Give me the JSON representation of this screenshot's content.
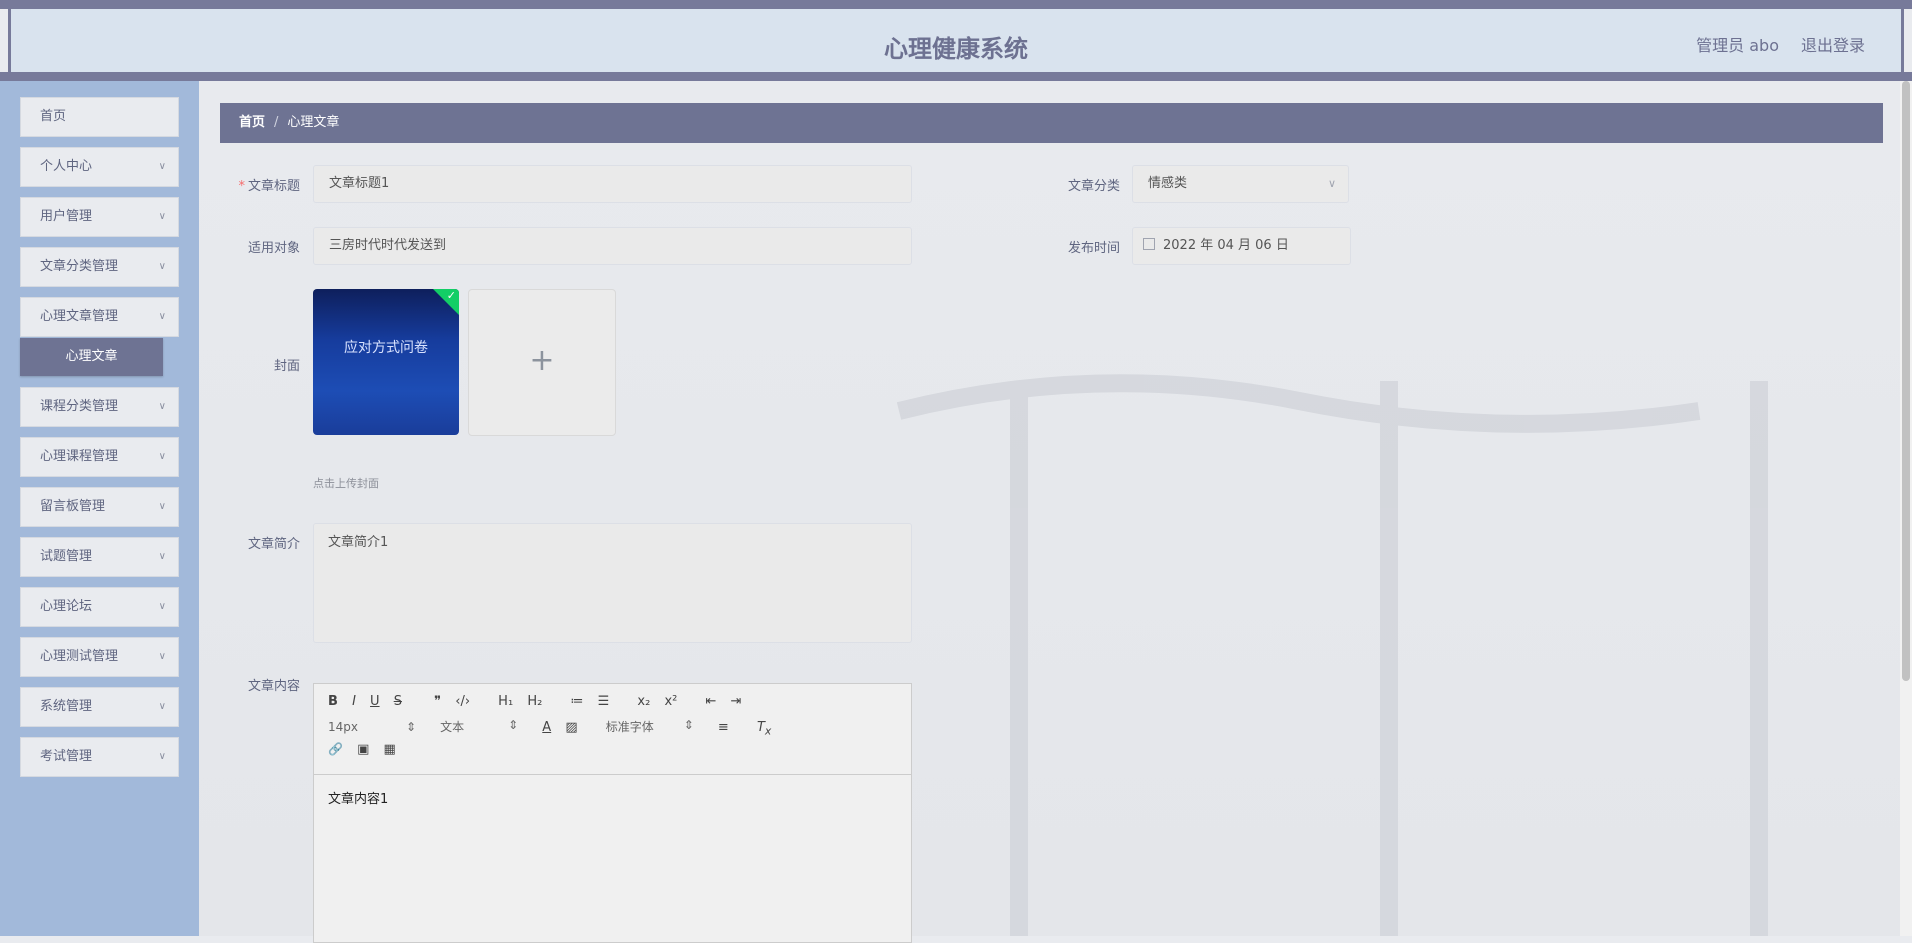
{
  "header": {
    "title": "心理健康系统",
    "user": "管理员 abo",
    "logout": "退出登录"
  },
  "sidebar": {
    "items": [
      {
        "label": "首页"
      },
      {
        "label": "个人中心"
      },
      {
        "label": "用户管理"
      },
      {
        "label": "文章分类管理"
      },
      {
        "label": "心理文章管理"
      },
      {
        "label": "课程分类管理"
      },
      {
        "label": "心理课程管理"
      },
      {
        "label": "留言板管理"
      },
      {
        "label": "试题管理"
      },
      {
        "label": "心理论坛"
      },
      {
        "label": "心理测试管理"
      },
      {
        "label": "系统管理"
      },
      {
        "label": "考试管理"
      }
    ],
    "active_submenu": "心理文章"
  },
  "breadcrumb": {
    "home": "首页",
    "separator": "/",
    "current": "心理文章"
  },
  "form": {
    "title_label": "文章标题",
    "title_value": "文章标题1",
    "category_label": "文章分类",
    "category_value": "情感类",
    "audience_label": "适用对象",
    "audience_value": "三房时代时代发送到",
    "publish_label": "发布时间",
    "publish_value": "2022 年 04 月 06 日",
    "cover_label": "封面",
    "cover_image_text": "应对方式问卷",
    "upload_plus": "+",
    "cover_hint": "点击上传封面",
    "summary_label": "文章简介",
    "summary_value": "文章简介1",
    "content_label": "文章内容",
    "content_value": "文章内容1"
  },
  "editor_toolbar": {
    "row1": [
      "B",
      "I",
      "U",
      "S",
      "❞",
      "‹/›",
      "H₁",
      "H₂",
      "≔",
      "☰",
      "x₂",
      "x²",
      "⇤",
      "⇥"
    ],
    "font_size": "14px",
    "block_type": "文本",
    "font_family": "标准字体",
    "row3": [
      "🔗",
      "▣",
      "▦"
    ]
  },
  "colors": {
    "accent": "#6e7393",
    "sidebar_bg": "#a2b9da",
    "header_bg": "#d9e3ee",
    "success": "#13ce66"
  }
}
